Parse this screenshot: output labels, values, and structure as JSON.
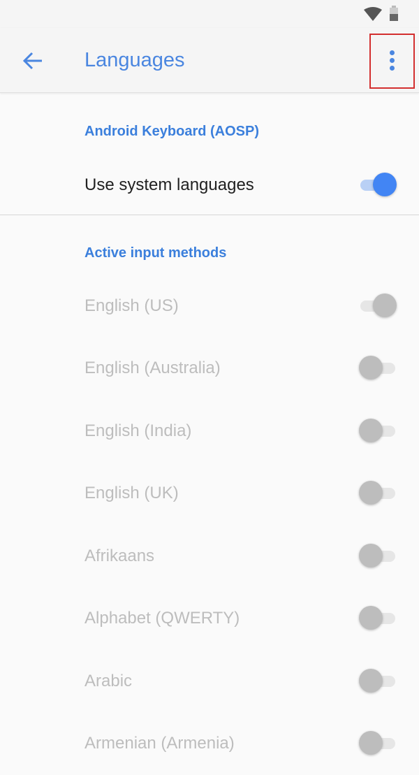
{
  "status_bar": {
    "wifi_icon": "wifi-icon",
    "battery_icon": "battery-icon"
  },
  "app_bar": {
    "title": "Languages",
    "back_icon": "arrow-left-icon",
    "menu_icon": "more-vert-icon"
  },
  "colors": {
    "accent": "#4a86e0",
    "switch_on_thumb": "#4285f4",
    "switch_on_track": "#b9d0f5",
    "switch_off_thumb": "#bdbdbd",
    "switch_off_track": "#e6e6e6",
    "highlight_box": "#d32f2f"
  },
  "sections": [
    {
      "header": "Android Keyboard (AOSP)",
      "items": [
        {
          "label": "Use system languages",
          "checked": true,
          "enabled": true
        }
      ]
    },
    {
      "header": "Active input methods",
      "items": [
        {
          "label": "English (US)",
          "checked": true,
          "enabled": false
        },
        {
          "label": "English (Australia)",
          "checked": false,
          "enabled": false
        },
        {
          "label": "English (India)",
          "checked": false,
          "enabled": false
        },
        {
          "label": "English (UK)",
          "checked": false,
          "enabled": false
        },
        {
          "label": "Afrikaans",
          "checked": false,
          "enabled": false
        },
        {
          "label": "Alphabet (QWERTY)",
          "checked": false,
          "enabled": false
        },
        {
          "label": "Arabic",
          "checked": false,
          "enabled": false
        },
        {
          "label": "Armenian (Armenia)",
          "checked": false,
          "enabled": false
        }
      ]
    }
  ]
}
